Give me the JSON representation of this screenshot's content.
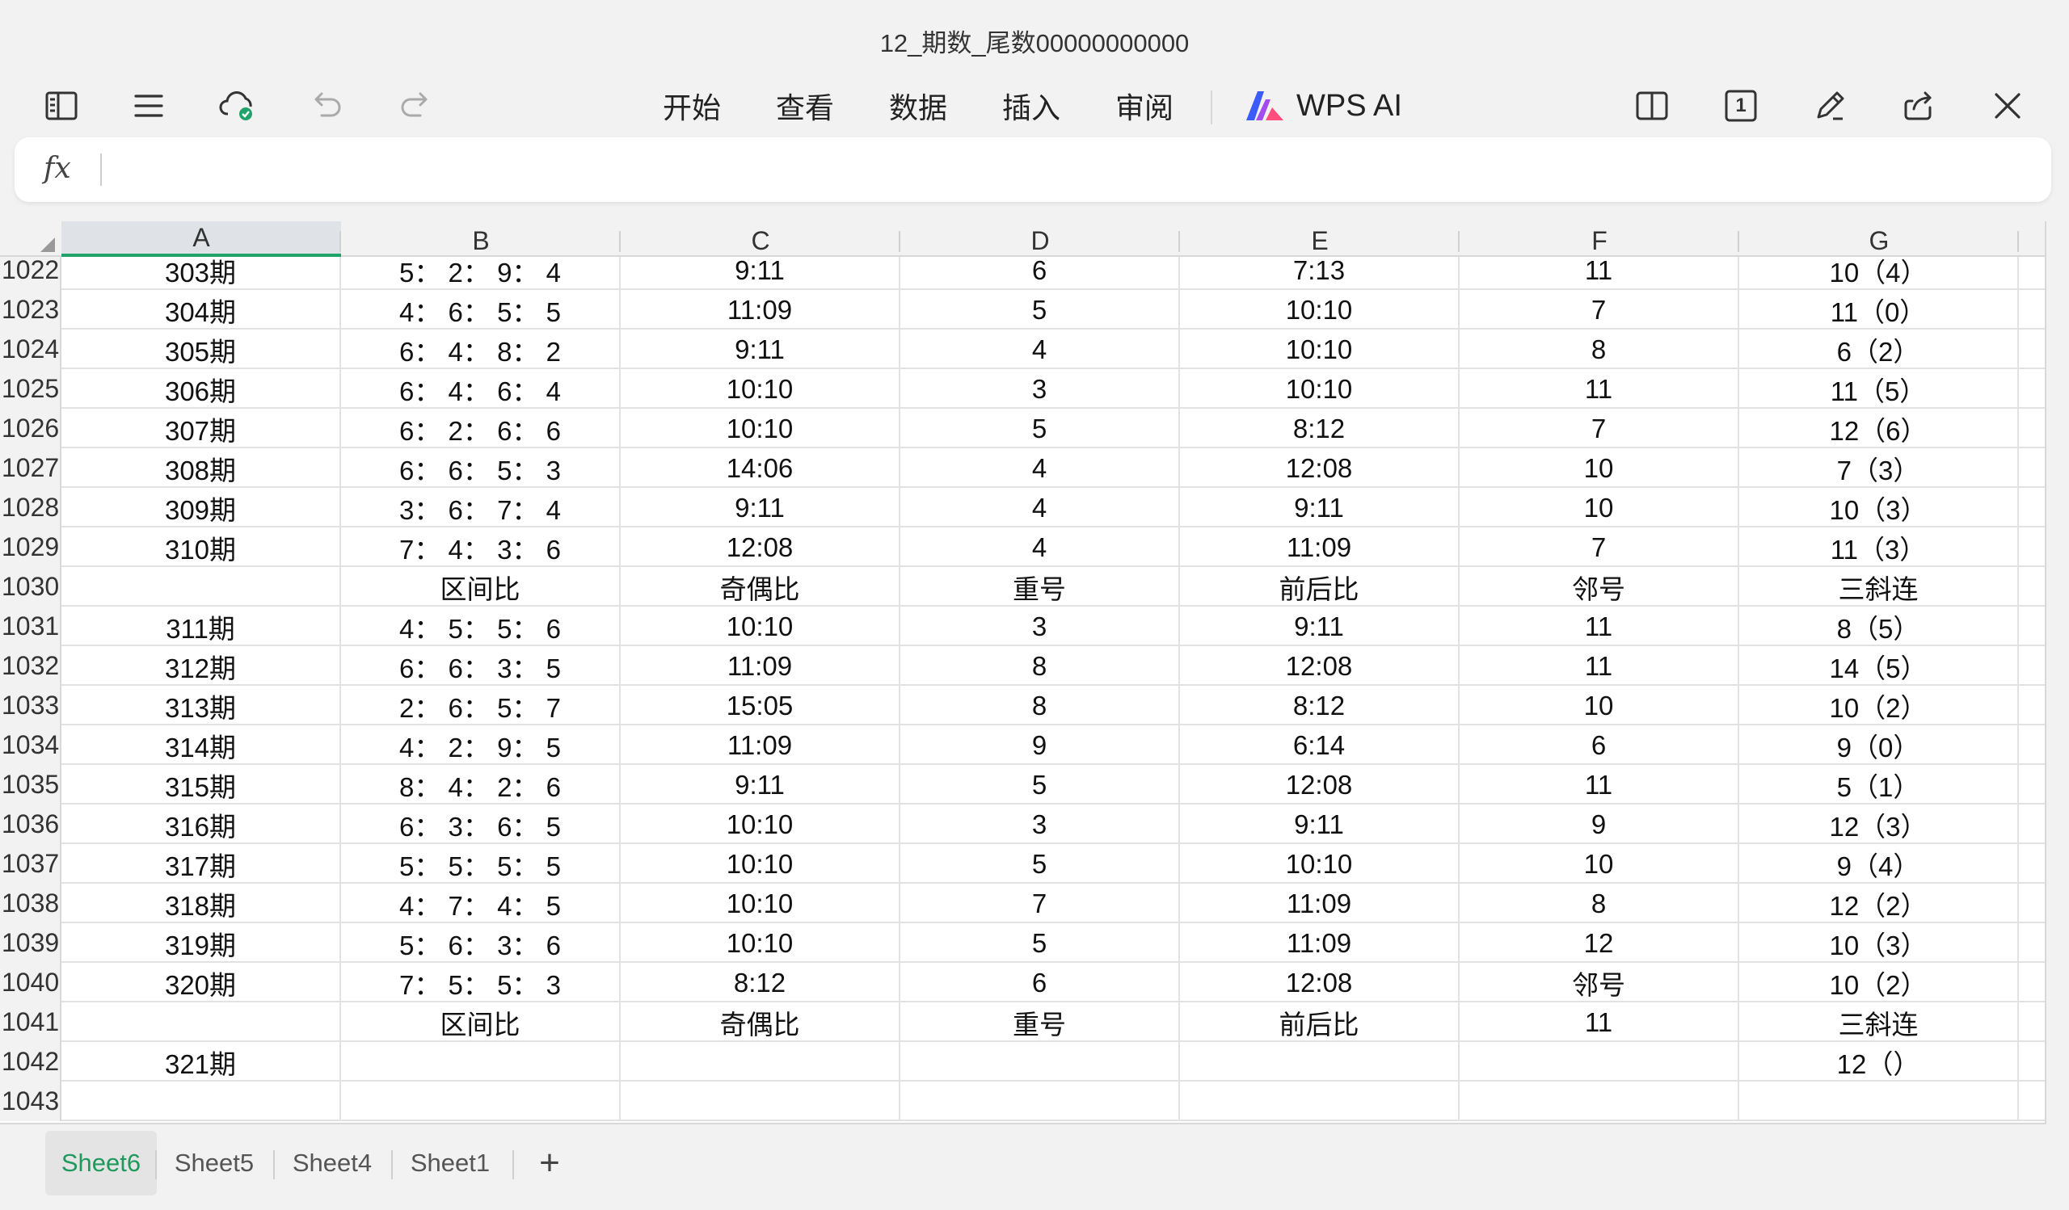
{
  "window": {
    "title": "12_期数_尾数00000000000"
  },
  "toolbar": {
    "menu": [
      "开始",
      "查看",
      "数据",
      "插入",
      "审阅"
    ],
    "ai_label": "WPS AI",
    "page_badge": "1"
  },
  "formula_bar": {
    "fx_label": "fx",
    "value": ""
  },
  "sheet": {
    "columns": [
      "A",
      "B",
      "C",
      "D",
      "E",
      "F",
      "G"
    ],
    "selected_column": "A",
    "rows": [
      {
        "num": "1022",
        "cells": [
          "303期",
          "5： 2： 9： 4",
          "9:11",
          "6",
          "7:13",
          "11",
          "10（4）"
        ]
      },
      {
        "num": "1023",
        "cells": [
          "304期",
          "4： 6： 5： 5",
          "11:09",
          "5",
          "10:10",
          "7",
          "11（0）"
        ]
      },
      {
        "num": "1024",
        "cells": [
          "305期",
          "6： 4： 8： 2",
          "9:11",
          "4",
          "10:10",
          "8",
          "6（2）"
        ]
      },
      {
        "num": "1025",
        "cells": [
          "306期",
          "6： 4： 6： 4",
          "10:10",
          "3",
          "10:10",
          "11",
          "11（5）"
        ]
      },
      {
        "num": "1026",
        "cells": [
          "307期",
          "6： 2： 6： 6",
          "10:10",
          "5",
          "8:12",
          "7",
          "12（6）"
        ]
      },
      {
        "num": "1027",
        "cells": [
          "308期",
          "6： 6： 5： 3",
          "14:06",
          "4",
          "12:08",
          "10",
          "7（3）"
        ]
      },
      {
        "num": "1028",
        "cells": [
          "309期",
          "3： 6： 7： 4",
          "9:11",
          "4",
          "9:11",
          "10",
          "10（3）"
        ]
      },
      {
        "num": "1029",
        "cells": [
          "310期",
          "7： 4： 3： 6",
          "12:08",
          "4",
          "11:09",
          "7",
          "11（3）"
        ]
      },
      {
        "num": "1030",
        "cells": [
          "",
          "区间比",
          "奇偶比",
          "重号",
          "前后比",
          "邻号",
          "三斜连"
        ]
      },
      {
        "num": "1031",
        "cells": [
          "311期",
          "4： 5： 5： 6",
          "10:10",
          "3",
          "9:11",
          "11",
          "8（5）"
        ]
      },
      {
        "num": "1032",
        "cells": [
          "312期",
          "6： 6： 3： 5",
          "11:09",
          "8",
          "12:08",
          "11",
          "14（5）"
        ]
      },
      {
        "num": "1033",
        "cells": [
          "313期",
          "2： 6： 5： 7",
          "15:05",
          "8",
          "8:12",
          "10",
          "10（2）"
        ]
      },
      {
        "num": "1034",
        "cells": [
          "314期",
          "4： 2： 9： 5",
          "11:09",
          "9",
          "6:14",
          "6",
          "9（0）"
        ]
      },
      {
        "num": "1035",
        "cells": [
          "315期",
          "8： 4： 2： 6",
          "9:11",
          "5",
          "12:08",
          "11",
          "5（1）"
        ]
      },
      {
        "num": "1036",
        "cells": [
          "316期",
          "6： 3： 6： 5",
          "10:10",
          "3",
          "9:11",
          "9",
          "12（3）"
        ]
      },
      {
        "num": "1037",
        "cells": [
          "317期",
          "5： 5： 5： 5",
          "10:10",
          "5",
          "10:10",
          "10",
          "9（4）"
        ]
      },
      {
        "num": "1038",
        "cells": [
          "318期",
          "4： 7： 4： 5",
          "10:10",
          "7",
          "11:09",
          "8",
          "12（2）"
        ]
      },
      {
        "num": "1039",
        "cells": [
          "319期",
          "5： 6： 3： 6",
          "10:10",
          "5",
          "11:09",
          "12",
          "10（3）"
        ]
      },
      {
        "num": "1040",
        "cells": [
          "320期",
          "7： 5： 5： 3",
          "8:12",
          "6",
          "12:08",
          "邻号",
          "10（2）"
        ]
      },
      {
        "num": "1041",
        "cells": [
          "",
          "区间比",
          "奇偶比",
          "重号",
          "前后比",
          "11",
          "三斜连"
        ]
      },
      {
        "num": "1042",
        "cells": [
          "321期",
          "",
          "",
          "",
          "",
          "",
          "12（）"
        ]
      },
      {
        "num": "1043",
        "cells": [
          "",
          "",
          "",
          "",
          "",
          "",
          ""
        ]
      }
    ]
  },
  "sheet_tabs": {
    "tabs": [
      "Sheet6",
      "Sheet5",
      "Sheet4",
      "Sheet1"
    ],
    "active": "Sheet6",
    "add_label": "+"
  },
  "colors": {
    "accent": "#20a26a",
    "active_tab_text": "#1d9a5c"
  }
}
